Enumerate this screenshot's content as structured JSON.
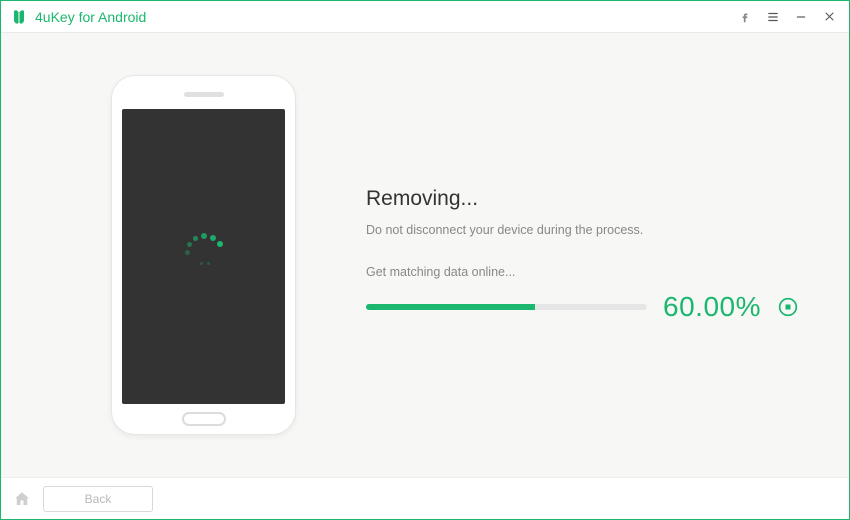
{
  "app": {
    "title": "4uKey for Android"
  },
  "main": {
    "heading": "Removing...",
    "warning": "Do not disconnect your device during the process.",
    "status": "Get matching data online...",
    "progress_percent": 60,
    "progress_label": "60.00%"
  },
  "footer": {
    "back_label": "Back"
  },
  "colors": {
    "accent": "#1bb76e"
  }
}
